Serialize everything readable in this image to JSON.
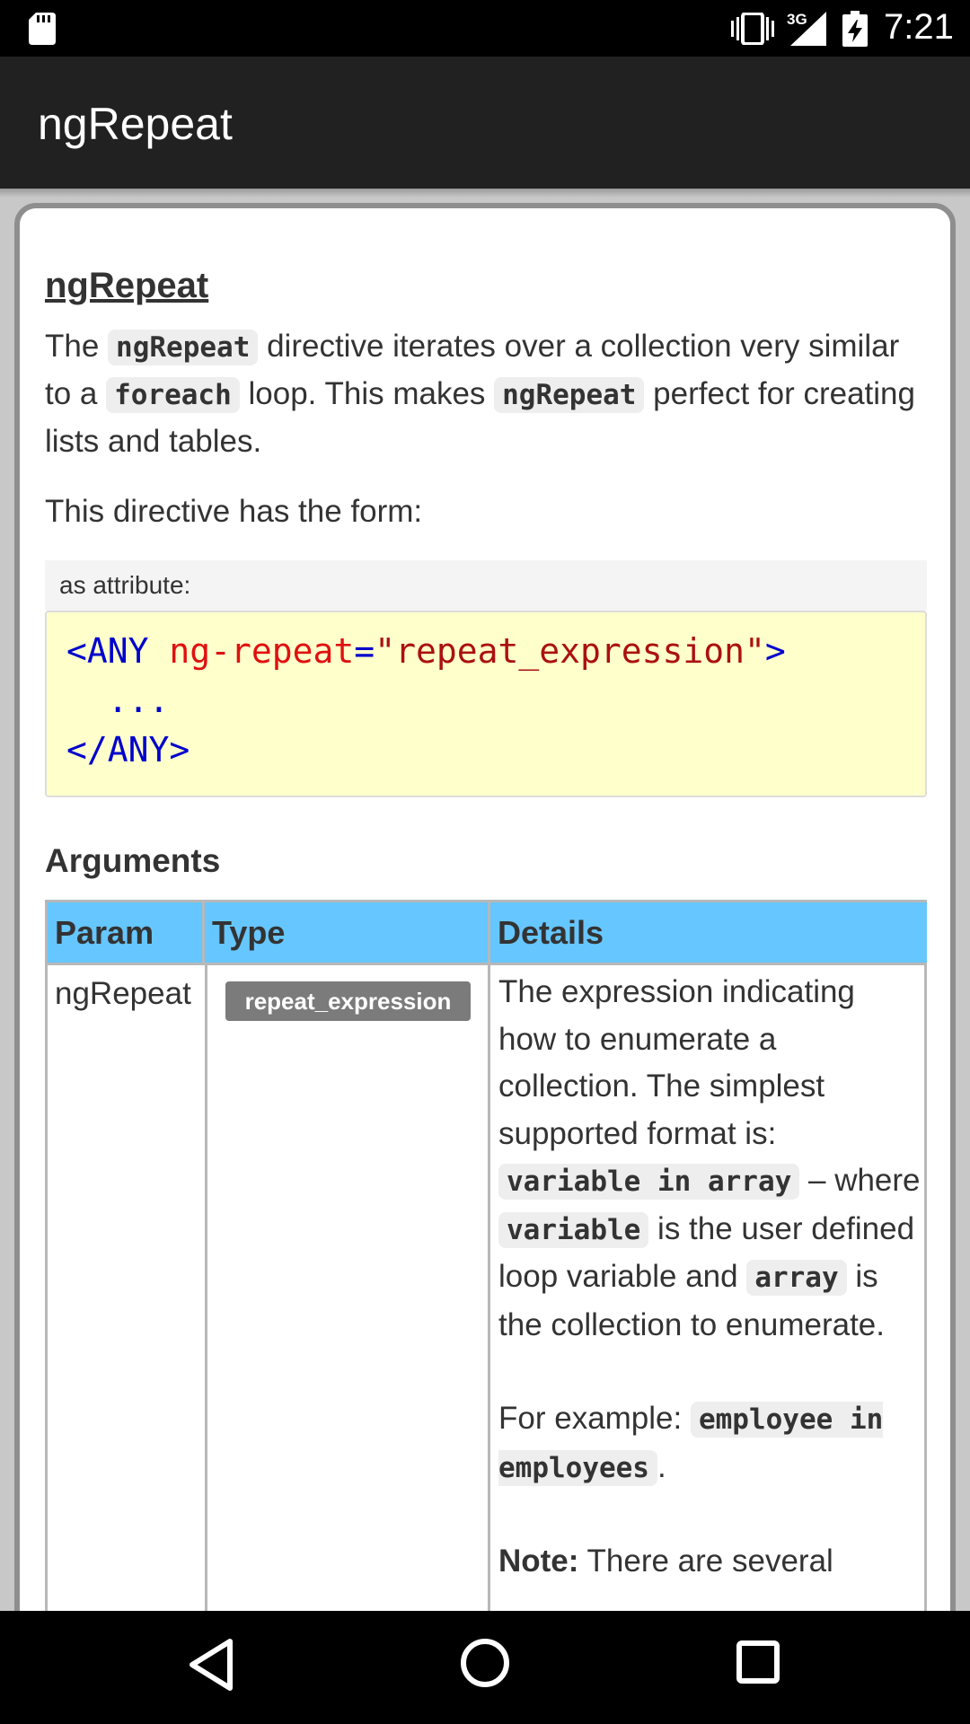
{
  "status_bar": {
    "network_type": "3G",
    "time": "7:21",
    "icons": [
      "sd-card-icon",
      "vibrate-icon",
      "signal-icon",
      "battery-icon"
    ]
  },
  "app_bar": {
    "title": "ngRepeat"
  },
  "doc": {
    "heading": "ngRepeat",
    "intro": {
      "t1": "The ",
      "c1": "ngRepeat",
      "t2": " directive iterates over a collection very similar to a ",
      "c2": "foreach",
      "t3": " loop. This makes ",
      "c3": "ngRepeat",
      "t4": " perfect for creating lists and tables."
    },
    "form_text": "This directive has the form:",
    "code_label": "as attribute:",
    "code": {
      "open_tag": "<ANY ",
      "attr_name": "ng-repeat",
      "equals": "=",
      "attr_value": "\"repeat_expression\"",
      "close_bracket": ">",
      "ellipsis": "  ...",
      "end_tag": "</ANY>"
    },
    "arguments_heading": "Arguments",
    "table": {
      "headers": [
        "Param",
        "Type",
        "Details"
      ],
      "row": {
        "param": "ngRepeat",
        "type": "repeat_expression",
        "details": {
          "d1": "The expression indicating how to enumerate a collection. The simplest supported format is: ",
          "dc1": "variable in array",
          "d2": " – where ",
          "dc2": "variable",
          "d3": " is the user defined loop variable and ",
          "dc3": "array",
          "d4": " is the collection to enumerate.",
          "ex_label": "For example: ",
          "ex_code": "employee in employees",
          "ex_end": ".",
          "note_label": "Note:",
          "note_text": " There are several"
        }
      }
    }
  },
  "nav_bar": {
    "icons": [
      "back-icon",
      "home-icon",
      "recents-icon"
    ]
  }
}
